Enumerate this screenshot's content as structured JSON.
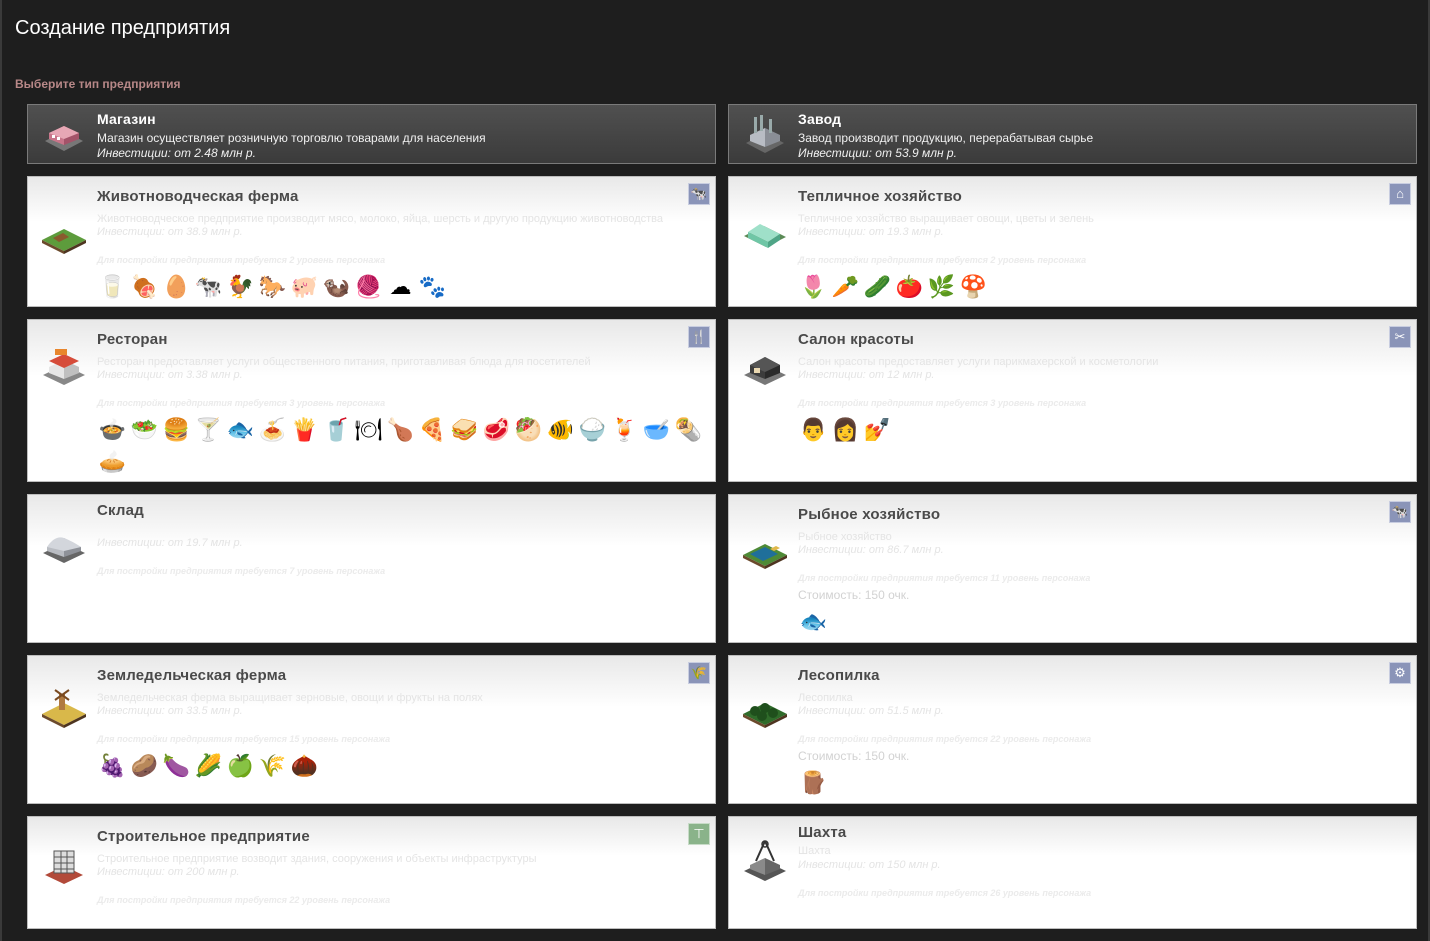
{
  "page": {
    "title": "Создание предприятия",
    "subtitle": "Выберите тип предприятия"
  },
  "shop": {
    "name": "Магазин",
    "description": "Магазин осуществляет розничную торговлю товарами для населения",
    "investment": "Инвестиции: от 2.48 млн  р."
  },
  "factory": {
    "name": "Завод",
    "description": "Завод производит продукцию, перерабатывая сырье",
    "investment": "Инвестиции: от 53.9 млн  р."
  },
  "livestock": {
    "name": "Животноводческая ферма",
    "faint_desc": "Животноводческое предприятие производит мясо, молоко, яйца, шерсть и другую продукцию животноводства",
    "investment": "Инвестиции: от 38.9 млн  р.",
    "requirement": "Для постройки предприятия требуется 2 уровень персонажа",
    "type_icon": "cow-icon",
    "products": [
      "milk-carton-icon",
      "meat-icon",
      "eggs-icon",
      "cow-icon",
      "chicken-icon",
      "horse-icon",
      "pig-icon",
      "mink-icon",
      "fur-icon",
      "wool-icon",
      "leather-icon"
    ]
  },
  "greenhouse": {
    "name": "Тепличное хозяйство",
    "faint_desc": "Тепличное хозяйство выращивает овощи, цветы и зелень",
    "investment": "Инвестиции: от 19.3 млн  р.",
    "requirement": "Для постройки предприятия требуется 2 уровень персонажа",
    "type_icon": "house-icon",
    "products": [
      "tulips-icon",
      "carrot-icon",
      "cucumber-icon",
      "tomato-icon",
      "herbs-icon",
      "mushrooms-icon"
    ]
  },
  "restaurant": {
    "name": "Ресторан",
    "faint_desc": "Ресторан предоставляет услуги общественного питания, приготавливая блюда для посетителей",
    "investment": "Инвестиции: от 3.38 млн  р.",
    "requirement": "Для постройки предприятия требуется 3 уровень персонажа",
    "type_icon": "fork-knife-icon",
    "products": [
      "soup-icon",
      "salad-icon",
      "burger-icon",
      "cocktail-icon",
      "fish-dish-icon",
      "pasta-icon",
      "fries-icon",
      "milkshake-icon",
      "plate-icon",
      "nuggets-icon",
      "pizza-icon",
      "sandwich-icon",
      "steak-icon",
      "greek-salad-icon",
      "herring-icon",
      "rice-icon",
      "juice-icon",
      "porridge-icon",
      "wrap-icon",
      "pie-icon"
    ]
  },
  "beauty": {
    "name": "Салон красоты",
    "faint_desc": "Салон красоты предоставляет услуги парикмахерской и косметологии",
    "investment": "Инвестиции: от 12 млн  р.",
    "requirement": "Для постройки предприятия требуется 3 уровень персонажа",
    "type_icon": "scissors-icon",
    "products": [
      "man-haircut-icon",
      "woman-haircut-icon",
      "manicure-icon"
    ]
  },
  "warehouse": {
    "name": "Склад",
    "investment": "Инвестиции: от 19.7 млн  р.",
    "requirement": "Для постройки предприятия требуется 7 уровень персонажа"
  },
  "fishery": {
    "name": "Рыбное хозяйство",
    "faint_desc": "Рыбное хозяйство",
    "investment": "Инвестиции: от 86.7 млн  р.",
    "requirement": "Для постройки предприятия требуется 11 уровень персонажа",
    "cost": "Стоимость: 150 очк.",
    "type_icon": "cow-icon",
    "products": [
      "fish-icon"
    ]
  },
  "agri": {
    "name": "Земледельческая ферма",
    "faint_desc": "Земледельческая ферма выращивает зерновые, овощи и фрукты на полях",
    "investment": "Инвестиции: от 33.5 млн  р.",
    "requirement": "Для постройки предприятия требуется 15 уровень персонажа",
    "type_icon": "wheat-icon",
    "products": [
      "grapes-icon",
      "potato-icon",
      "beet-icon",
      "corn-icon",
      "apple-icon",
      "grain-icon",
      "cocoa-icon"
    ]
  },
  "sawmill": {
    "name": "Лесопилка",
    "faint_desc": "Лесопилка",
    "investment": "Инвестиции: от 51.5 млн  р.",
    "requirement": "Для постройки предприятия требуется 22 уровень персонажа",
    "cost": "Стоимость: 150 очк.",
    "type_icon": "gear-icon",
    "products": [
      "planks-icon"
    ]
  },
  "construction": {
    "name": "Строительное предприятие",
    "faint_desc": "Строительное предприятие возводит здания, сооружения и объекты инфраструктуры",
    "investment": "Инвестиции: от 200 млн  р.",
    "requirement": "Для постройки предприятия требуется 22 уровень персонажа",
    "type_icon": "hammer-icon"
  },
  "mine": {
    "name": "Шахта",
    "faint_desc": "Шахта",
    "investment": "Инвестиции: от 150 млн  р.",
    "requirement": "Для постройки предприятия требуется 26 уровень персонажа"
  },
  "colors": {
    "background": "#1e1e1e",
    "subtitle": "#b88888",
    "card_dark": "#454545",
    "card_light": "#ffffff"
  }
}
